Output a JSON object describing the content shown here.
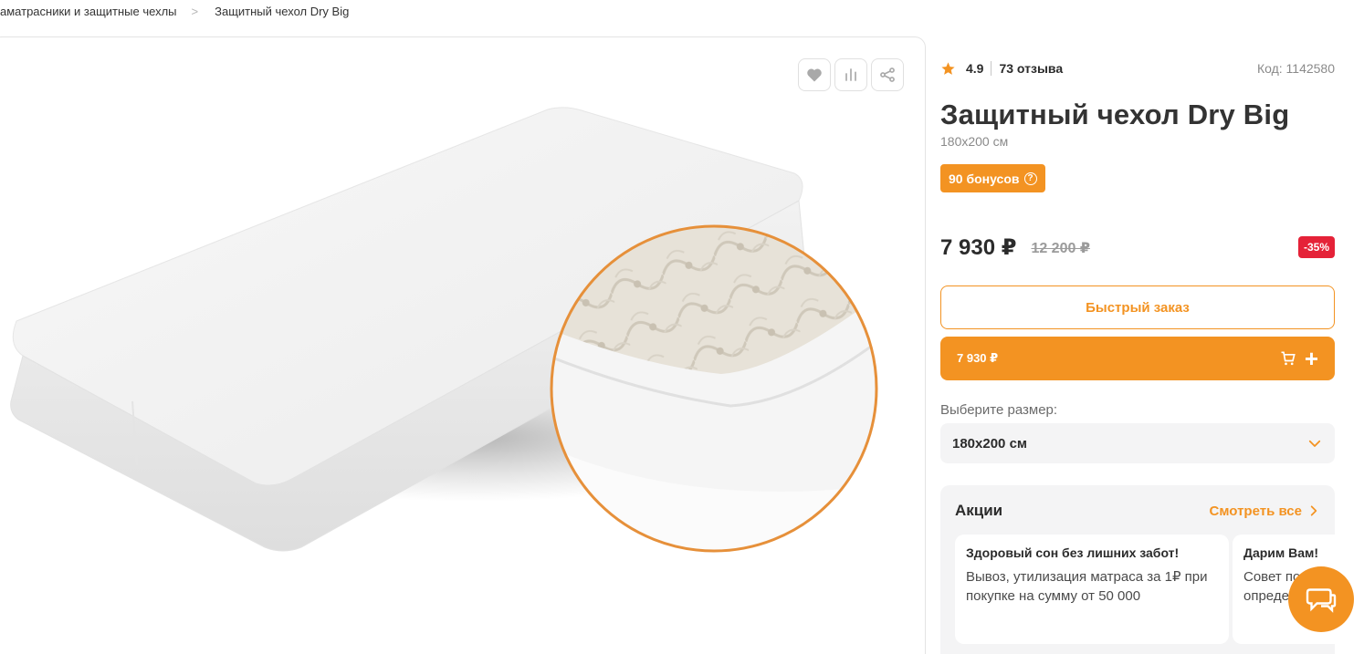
{
  "breadcrumb": {
    "items": [
      "аматрасники и защитные чехлы",
      "Защитный чехол Dry Big"
    ],
    "separator": ">"
  },
  "gallery": {
    "actions": [
      "heart-icon",
      "compare-icon",
      "share-icon"
    ]
  },
  "product": {
    "rating": "4.9",
    "reviews": "73 отзыва",
    "code": "Код: 1142580",
    "title": "Защитный чехол Dry Big",
    "subtitle": "180х200 см",
    "bonus": "90 бонусов",
    "price": "7 930 ₽",
    "old_price": "12 200 ₽",
    "discount": "-35%"
  },
  "actions": {
    "quick_order": "Быстрый заказ",
    "cart_price": "7 930 ₽",
    "cart_plus": "+"
  },
  "size": {
    "label": "Выберите размер:",
    "selected": "180х200 см"
  },
  "promos": {
    "title": "Акции",
    "see_all": "Смотреть все",
    "cards": [
      {
        "title": "Здоровый сон без лишних забот!",
        "desc": "Вывоз, утилизация матраса за 1₽ при покупке на сумму от 50 000"
      },
      {
        "title": "Дарим Вам!",
        "desc": "Совет по определе"
      }
    ]
  },
  "colors": {
    "accent": "#f39322",
    "discount": "#e52238",
    "star": "#f39322"
  }
}
